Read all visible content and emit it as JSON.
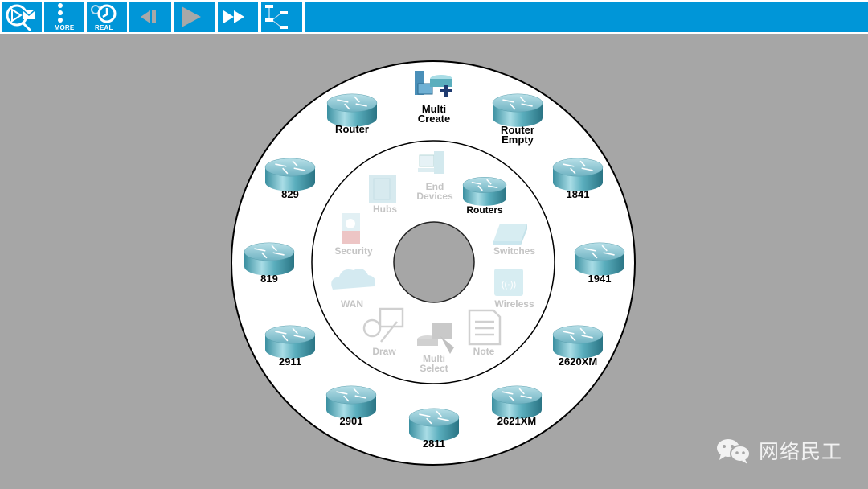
{
  "toolbar": {
    "buttons": [
      {
        "name": "inspect",
        "icon": "inspect-icon",
        "label": ""
      },
      {
        "name": "more",
        "icon": "more-dots-icon",
        "label": "MORE"
      },
      {
        "name": "realtime",
        "icon": "realtime-clock-icon",
        "label": "REAL"
      },
      {
        "name": "back",
        "icon": "step-back-icon",
        "label": ""
      },
      {
        "name": "play",
        "icon": "play-icon",
        "label": ""
      },
      {
        "name": "fast-forward",
        "icon": "fast-forward-icon",
        "label": ""
      },
      {
        "name": "topology",
        "icon": "topology-tree-icon",
        "label": ""
      }
    ],
    "accent": "#0096d8"
  },
  "outer_ring": {
    "items": [
      {
        "label": "Router",
        "icon": "router-icon"
      },
      {
        "label": "Multi\nCreate",
        "line1": "Multi",
        "line2": "Create",
        "icon": "multi-create-icon"
      },
      {
        "label": "Router Empty",
        "line1": "Router",
        "line2": "Empty",
        "icon": "router-icon"
      },
      {
        "label": "1841",
        "icon": "router-icon"
      },
      {
        "label": "1941",
        "icon": "router-icon"
      },
      {
        "label": "2620XM",
        "icon": "router-icon"
      },
      {
        "label": "2621XM",
        "icon": "router-icon"
      },
      {
        "label": "2811",
        "icon": "router-icon"
      },
      {
        "label": "2901",
        "icon": "router-icon"
      },
      {
        "label": "2911",
        "icon": "router-icon"
      },
      {
        "label": "819",
        "icon": "router-icon"
      },
      {
        "label": "829",
        "icon": "router-icon"
      }
    ]
  },
  "inner_ring": {
    "items": [
      {
        "label": "End Devices",
        "line1": "End",
        "line2": "Devices",
        "icon": "end-devices-icon",
        "active": false
      },
      {
        "label": "Routers",
        "icon": "router-icon",
        "active": true
      },
      {
        "label": "Switches",
        "icon": "switch-icon",
        "active": false
      },
      {
        "label": "Wireless",
        "icon": "wireless-icon",
        "active": false
      },
      {
        "label": "Note",
        "icon": "note-icon",
        "active": false
      },
      {
        "label": "Multi Select",
        "line1": "Multi",
        "line2": "Select",
        "icon": "multi-select-icon",
        "active": false
      },
      {
        "label": "Draw",
        "icon": "draw-icon",
        "active": false
      },
      {
        "label": "WAN",
        "icon": "wan-cloud-icon",
        "active": false
      },
      {
        "label": "Security",
        "icon": "security-icon",
        "active": false
      },
      {
        "label": "Hubs",
        "icon": "hub-icon",
        "active": false
      }
    ]
  },
  "watermark": {
    "text": "网络民工",
    "icon": "wechat-icon"
  }
}
